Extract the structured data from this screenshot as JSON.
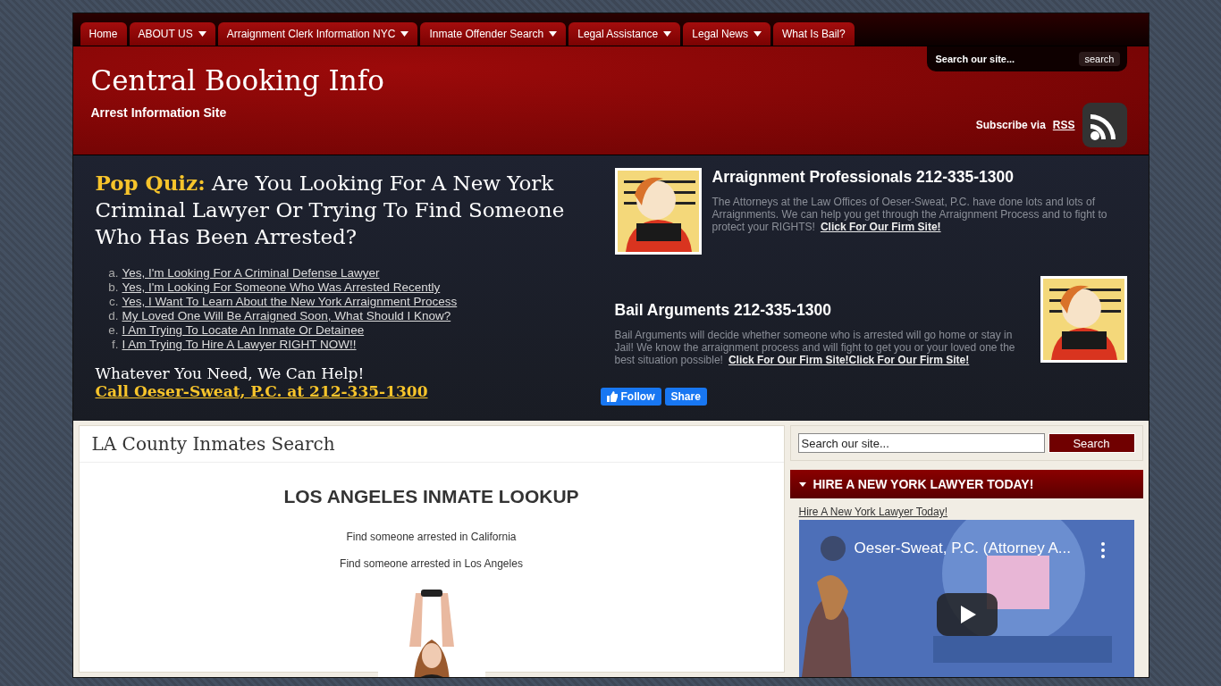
{
  "nav": [
    {
      "label": "Home",
      "dropdown": false
    },
    {
      "label": "ABOUT US",
      "dropdown": true
    },
    {
      "label": "Arraignment Clerk Information NYC",
      "dropdown": true
    },
    {
      "label": "Inmate Offender Search",
      "dropdown": true
    },
    {
      "label": "Legal Assistance",
      "dropdown": true
    },
    {
      "label": "Legal News",
      "dropdown": true
    },
    {
      "label": "What Is Bail?",
      "dropdown": false
    }
  ],
  "header": {
    "title": "Central Booking Info",
    "tagline": "Arrest Information Site",
    "search": {
      "placeholder": "Search our site...",
      "button": "search"
    },
    "subscribe": {
      "text": "Subscribe via",
      "link": "RSS"
    }
  },
  "promo": {
    "quiz": {
      "lead": "Pop Quiz:",
      "question": "Are You Looking For A New York Criminal Lawyer Or Trying To Find Someone Who Has Been Arrested?"
    },
    "options": [
      {
        "marker": "a.",
        "label": "Yes, I'm Looking For A Criminal Defense Lawyer"
      },
      {
        "marker": "b.",
        "label": "Yes, I'm Looking For Someone Who Was Arrested Recently"
      },
      {
        "marker": "c.",
        "label": "Yes, I Want To Learn About the New York Arraignment Process"
      },
      {
        "marker": "d.",
        "label": "My Loved One Will Be Arraigned Soon, What Should I Know?"
      },
      {
        "marker": "e.",
        "label": "I Am Trying To Locate An Inmate Or Detainee"
      },
      {
        "marker": "f.",
        "label": "I Am Trying To Hire A Lawyer RIGHT NOW!!"
      }
    ],
    "help": "Whatever You Need, We Can Help!",
    "call": "Call Oeser-Sweat, P.C. at 212-335-1300",
    "ads": [
      {
        "title": "Arraignment Professionals 212-335-1300",
        "kind": "image_left",
        "body": "The Attorneys at the Law Offices of Oeser-Sweat, P.C. have done lots and lots of Arraignments. We can help you get through the Arraignment Process and to fight to protect your RIGHTS!",
        "link": "Click For Our Firm Site!"
      },
      {
        "title": "Bail Arguments 212-335-1300",
        "kind": "image_right",
        "body": "Bail Arguments will decide whether someone who is arrested will go home or stay in Jail! We know the arraignment process and will fight to get you or your loved one the best situation possible!",
        "link": "Click For Our Firm Site!Click For Our Firm Site!"
      }
    ],
    "social": {
      "follow": "Follow",
      "share": "Share"
    }
  },
  "main": {
    "title": "LA County Inmates Search",
    "heading": "LOS ANGELES INMATE LOOKUP",
    "lines": [
      "Find someone arrested in California",
      "Find someone arrested in Los Angeles"
    ]
  },
  "sidebar": {
    "search": {
      "placeholder": "Search our site...",
      "button": "Search"
    },
    "widget": {
      "title": "HIRE A NEW YORK LAWYER TODAY!",
      "link": "Hire A New York Lawyer Today!",
      "video": {
        "title": "Oeser-Sweat, P.C. (Attorney A..."
      }
    }
  }
}
